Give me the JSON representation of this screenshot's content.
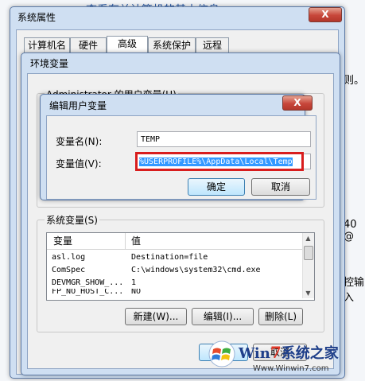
{
  "background": {
    "title": "查看有关计算机的基本信息",
    "close_label": "X",
    "side_text_1": "则。",
    "side_text_2": "40 @",
    "side_text_3": "控输入"
  },
  "sys_props": {
    "title": "系统属性",
    "tabs": [
      "计算机名",
      "硬件",
      "高级",
      "系统保护",
      "远程"
    ]
  },
  "env_vars": {
    "title": "环境变量",
    "user_vars_label": "Administrator 的用户变量(U)",
    "system_vars_label": "系统变量(S)",
    "columns": [
      "变量",
      "值"
    ],
    "rows": [
      {
        "name": "asl.log",
        "value": "Destination=file"
      },
      {
        "name": "ComSpec",
        "value": "C:\\windows\\system32\\cmd.exe"
      },
      {
        "name": "DEVMGR_SHOW_...",
        "value": "1"
      },
      {
        "name": "FP_NO_HOST_C...",
        "value": "NO"
      }
    ],
    "new_button": "新建(W)...",
    "edit_button": "编辑(I)...",
    "delete_button": "删除(L)",
    "ok_button": "确定",
    "cancel_button": "取消"
  },
  "edit_dialog": {
    "title": "编辑用户变量",
    "close_label": "X",
    "name_label": "变量名(N):",
    "name_value": "TEMP",
    "value_label": "变量值(V):",
    "value_value": "%USERPROFILE%\\AppData\\Local\\Temp",
    "ok_button": "确定",
    "cancel_button": "取消"
  },
  "watermark": {
    "brand_a": "Win",
    "brand_digit": "7",
    "brand_b": "系统之家",
    "url": "Www.Winwin7.com"
  },
  "colors": {
    "selection": "#3399ff",
    "highlight_box": "#d81d1d",
    "close_button": "#c7463a"
  }
}
